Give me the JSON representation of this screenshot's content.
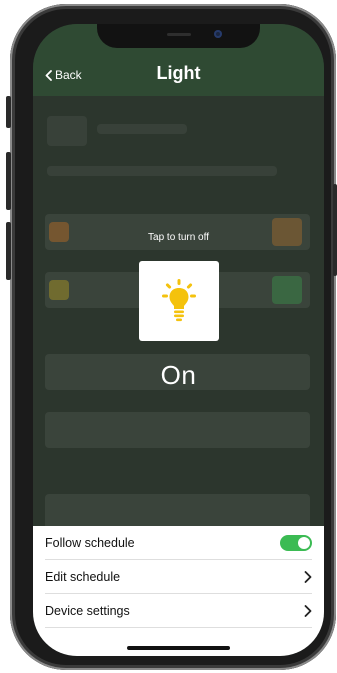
{
  "header": {
    "back_label": "Back",
    "title": "Light"
  },
  "device": {
    "hint": "Tap to turn off",
    "state": "On",
    "icon": "lightbulb-icon"
  },
  "sheet": {
    "items": [
      {
        "label": "Follow schedule",
        "control": "toggle",
        "toggle_on": true
      },
      {
        "label": "Edit schedule",
        "control": "chevron"
      },
      {
        "label": "Device settings",
        "control": "chevron"
      }
    ]
  },
  "colors": {
    "header": "#2f4a33",
    "toggle_on": "#3bbb53",
    "bulb": "#f4c20d"
  }
}
